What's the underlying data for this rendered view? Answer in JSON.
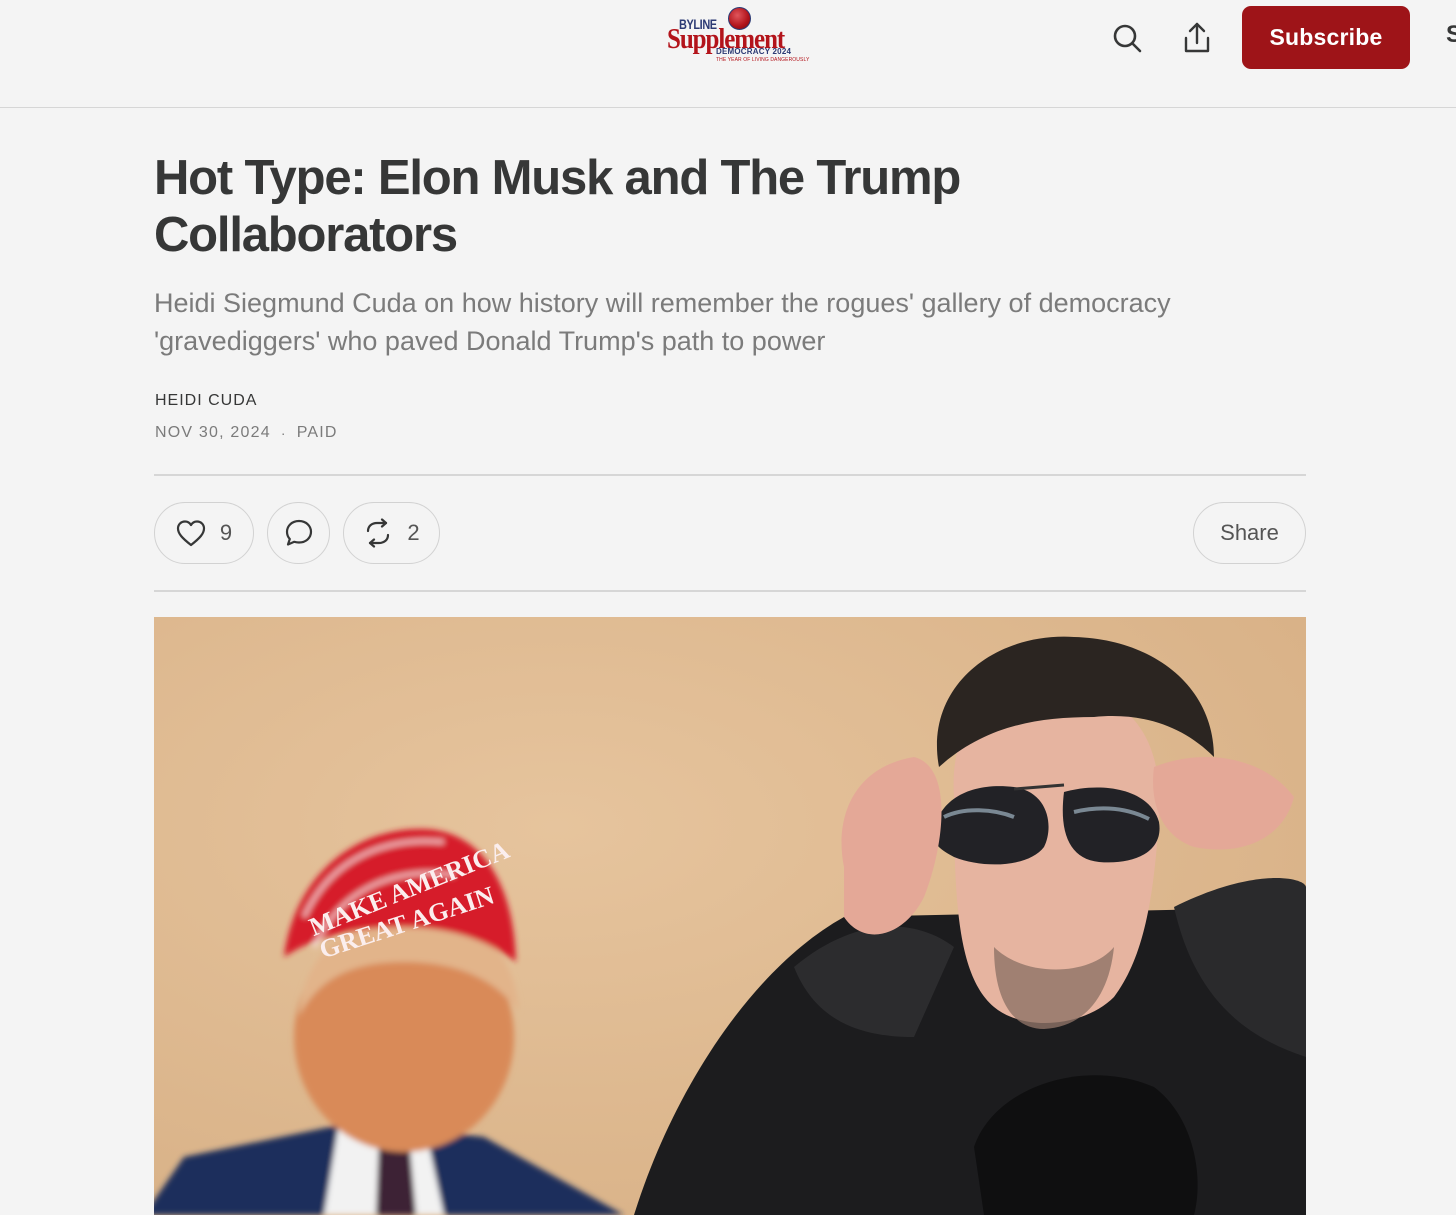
{
  "header": {
    "logo": {
      "byline": "BYLINE",
      "supplement": "Supplement",
      "democracy": "DEMOCRACY 2024",
      "tagline": "THE YEAR OF LIVING DANGEROUSLY"
    },
    "search_icon": "search-icon",
    "share_icon": "share-upload-icon",
    "subscribe_label": "Subscribe",
    "edge_glyph": "S"
  },
  "post": {
    "title": "Hot Type: Elon Musk and The Trump Collaborators",
    "subtitle": "Heidi Siegmund Cuda on how history will remember the rogues' gallery of democracy 'gravediggers' who paved Donald Trump's path to power",
    "author": "HEIDI CUDA",
    "date": "NOV 30, 2024",
    "separator": "·",
    "access": "PAID"
  },
  "actions": {
    "like_count": "9",
    "restack_count": "2",
    "share_label": "Share"
  },
  "hero_image": {
    "cap_line1": "MAKE AMERICA",
    "cap_line2": "GREAT AGAIN"
  },
  "colors": {
    "brand": "#9e1418",
    "text": "#363737",
    "muted": "#7b7b7b",
    "background": "#f4f4f4"
  }
}
